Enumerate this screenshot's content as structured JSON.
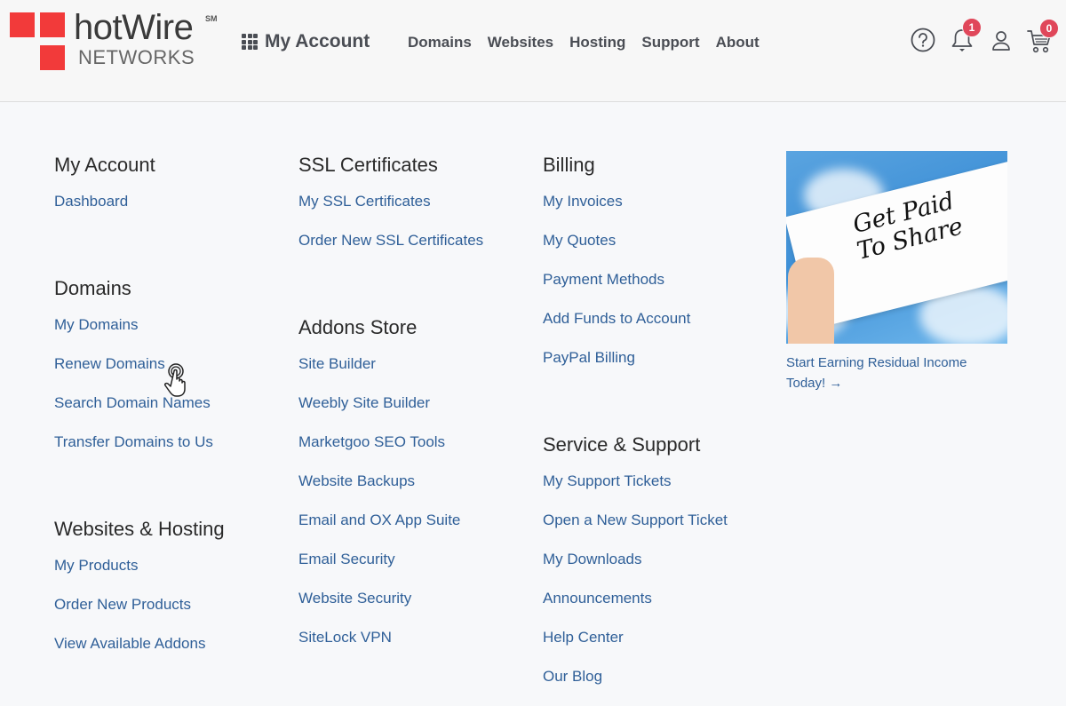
{
  "header": {
    "logo": {
      "brand": "hotWire",
      "service_mark": "SM",
      "sub": "NETWORKS",
      "accent_color": "#f23a3a"
    },
    "my_account": {
      "icon": "grid-icon",
      "label": "My Account"
    },
    "nav": [
      "Domains",
      "Websites",
      "Hosting",
      "Support",
      "About"
    ],
    "icons": {
      "help": {
        "icon": "help-circle-icon"
      },
      "notifications": {
        "icon": "bell-icon",
        "badge": "1"
      },
      "account": {
        "icon": "user-icon"
      },
      "cart": {
        "icon": "cart-icon",
        "badge": "0"
      },
      "badge_color": "#e0475a"
    }
  },
  "menu": {
    "link_color": "#2f5f98",
    "col1": [
      {
        "title": "My Account",
        "links": [
          "Dashboard"
        ]
      },
      {
        "title": "Domains",
        "links": [
          "My Domains",
          "Renew Domains",
          "Search Domain Names",
          "Transfer Domains to Us"
        ]
      },
      {
        "title": "Websites & Hosting",
        "links": [
          "My Products",
          "Order New Products",
          "View Available Addons"
        ]
      }
    ],
    "col2": [
      {
        "title": "SSL Certificates",
        "links": [
          "My SSL Certificates",
          "Order New SSL Certificates"
        ]
      },
      {
        "title": "Addons Store",
        "links": [
          "Site Builder",
          "Weebly Site Builder",
          "Marketgoo SEO Tools",
          "Website Backups",
          "Email and OX App Suite",
          "Email Security",
          "Website Security",
          "SiteLock VPN"
        ]
      }
    ],
    "col3": [
      {
        "title": "Billing",
        "links": [
          "My Invoices",
          "My Quotes",
          "Payment Methods",
          "Add Funds to Account",
          "PayPal Billing"
        ]
      },
      {
        "title": "Service & Support",
        "links": [
          "My Support Tickets",
          "Open a New Support Ticket",
          "My Downloads",
          "Announcements",
          "Help Center",
          "Our Blog"
        ]
      }
    ]
  },
  "promo": {
    "image_text_line1": "Get Paid",
    "image_text_line2": "To Share",
    "link_text": "Start Earning Residual Income Today! →"
  }
}
